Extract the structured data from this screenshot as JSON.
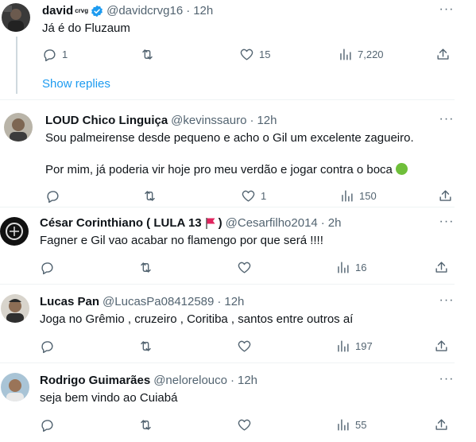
{
  "colors": {
    "accent": "#1d9bf0",
    "secondary_text": "#536471",
    "divider": "#eff3f4"
  },
  "show_replies_label": "Show replies",
  "tweets": [
    {
      "name": "david",
      "name_badge": "crvg",
      "verified": true,
      "handle": "@davidcrvg16",
      "time": "12h",
      "text_lines": [
        "Já é do Fluzaum"
      ],
      "replies": "1",
      "retweets": "",
      "likes": "15",
      "views": "7,220"
    },
    {
      "name": "LOUD Chico Linguiça",
      "handle": "@kevinssauro",
      "time": "12h",
      "text_lines": [
        "Sou palmeirense desde pequeno e acho o Gil um excelente zagueiro.",
        "Por mim, já poderia vir hoje pro meu verdão e jogar contra o boca"
      ],
      "replies": "",
      "retweets": "",
      "likes": "1",
      "views": "150"
    },
    {
      "name": "César Corinthiano ( LULA 13",
      "name_suffix": ")",
      "handle": "@Cesarfilho2014",
      "time": "2h",
      "text_lines": [
        "Fagner e Gil vao acabar no flamengo por que será !!!!"
      ],
      "replies": "",
      "retweets": "",
      "likes": "",
      "views": "16"
    },
    {
      "name": "Lucas Pan",
      "handle": "@LucasPa08412589",
      "time": "12h",
      "text_lines": [
        "Joga no Grêmio , cruzeiro , Coritiba , santos entre outros aí"
      ],
      "replies": "",
      "retweets": "",
      "likes": "",
      "views": "197"
    },
    {
      "name": "Rodrigo Guimarães",
      "handle": "@nelorelouco",
      "time": "12h",
      "text_lines": [
        "seja bem vindo ao Cuiabá"
      ],
      "replies": "",
      "retweets": "",
      "likes": "",
      "views": "55"
    }
  ],
  "icons": [
    "reply-icon",
    "retweet-icon",
    "like-icon",
    "views-icon",
    "share-icon",
    "more-icon",
    "verified-icon",
    "flag-icon"
  ],
  "dot": "·"
}
